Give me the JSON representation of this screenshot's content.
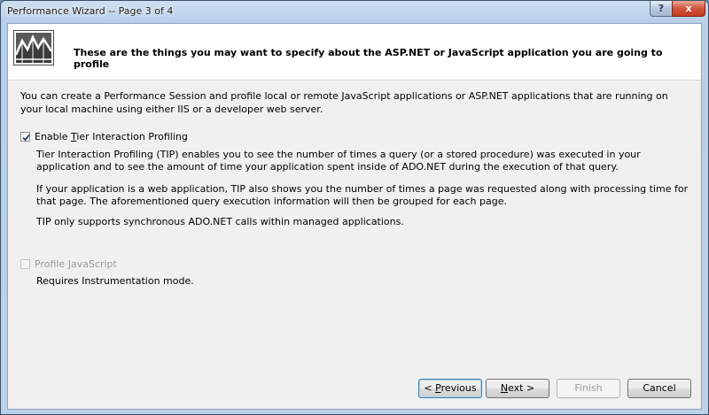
{
  "window": {
    "title": "Performance Wizard -- Page 3 of 4",
    "help_glyph": "?",
    "close_glyph": "x"
  },
  "header": {
    "text": "These are the things you may want to specify about the ASP.NET or JavaScript application you are going to profile",
    "logo_icon": "performance-chart-icon"
  },
  "intro": "You can create a Performance Session and profile local or remote JavaScript applications or ASP.NET applications that are running on your local machine using either IIS or a developer web server.",
  "tip": {
    "checked": true,
    "label_pre": "Enable ",
    "label_mnemonic": "T",
    "label_post": "ier Interaction Profiling",
    "description_1": "Tier Interaction Profiling (TIP) enables you to see the number of times a query (or a stored procedure) was executed in your application and to see the amount of time your application spent inside of ADO.NET during the execution of that query.",
    "description_2": "If your application is a web application, TIP also shows you the number of times a page was requested along with processing time for that page. The aforementioned query execution information will then be grouped for each page.",
    "description_3": "TIP only supports synchronous ADO.NET calls within managed applications."
  },
  "javascript": {
    "checked": false,
    "enabled": false,
    "label_pre": "Profile ",
    "label_mnemonic": "J",
    "label_post": "avaScript",
    "note": "Requires Instrumentation mode."
  },
  "buttons": {
    "previous_pre": "< ",
    "previous_mnemonic": "P",
    "previous_post": "revious",
    "next_mnemonic": "N",
    "next_post": "ext >",
    "finish": "Finish",
    "cancel": "Cancel"
  }
}
